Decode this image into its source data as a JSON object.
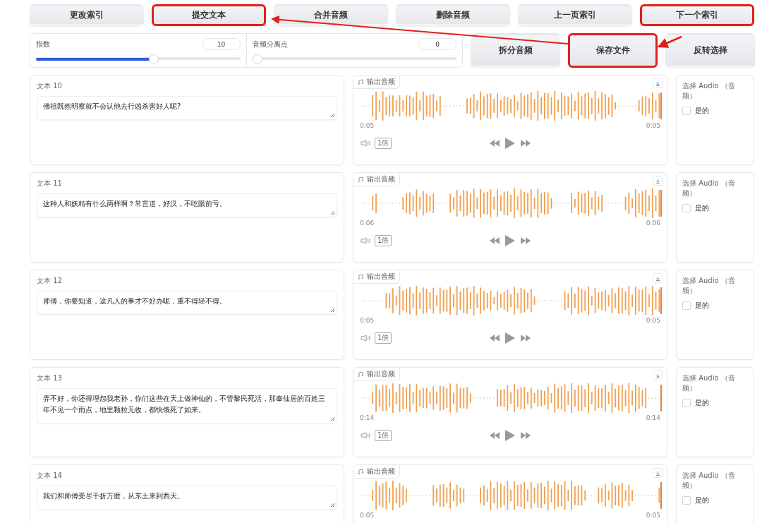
{
  "top_buttons": [
    {
      "label": "更改索引",
      "highlighted": false
    },
    {
      "label": "提交文本",
      "highlighted": true
    },
    {
      "label": "合并音频",
      "highlighted": false
    },
    {
      "label": "删除音频",
      "highlighted": false
    },
    {
      "label": "上一页索引",
      "highlighted": false
    },
    {
      "label": "下一个索引",
      "highlighted": true
    }
  ],
  "sliders": [
    {
      "label": "指数",
      "value": "10",
      "level": 0.58
    },
    {
      "label": "音频分离点",
      "value": "0",
      "level": 0
    }
  ],
  "side_buttons": [
    {
      "label": "拆分音频",
      "highlighted": false
    },
    {
      "label": "保存文件",
      "highlighted": true
    },
    {
      "label": "反转选择",
      "highlighted": false
    }
  ],
  "rows": [
    {
      "label": "文本 10",
      "text": "佛祖既然明察就不会认他去行凶杀害好人呢?",
      "audio": {
        "label": "输出音频",
        "start": "0:05",
        "end": "0:05",
        "speed": "1倍"
      },
      "select": {
        "label": "选择 Audio （音频）",
        "option": "是的",
        "checked": false
      }
    },
    {
      "label": "文本 11",
      "text": "这种人和妖精有什么两样啊？常言道，好汉，不吃眼前亏。",
      "audio": {
        "label": "输出音频",
        "start": "0:06",
        "end": "0:06",
        "speed": "1倍"
      },
      "select": {
        "label": "选择 Audio （音频）",
        "option": "是的",
        "checked": false
      }
    },
    {
      "label": "文本 12",
      "text": "师傅，你要知道，这凡人的事才不好办呢，重不得轻不得。",
      "audio": {
        "label": "输出音频",
        "start": "0:05",
        "end": "0:05",
        "speed": "1倍"
      },
      "select": {
        "label": "选择 Audio （音频）",
        "option": "是的",
        "checked": false
      }
    },
    {
      "label": "文本 13",
      "text": "弄不好，你还得埋怨我老孙，你们这些在天上做神仙的，不管黎民死活，那奉仙居的百姓三年不见一个雨点，地里颗粒无收，都快饿死了如来。",
      "audio": {
        "label": "输出音频",
        "start": "0:14",
        "end": "0:14",
        "speed": "1倍"
      },
      "select": {
        "label": "选择 Audio （音频）",
        "option": "是的",
        "checked": false
      }
    },
    {
      "label": "文本 14",
      "text": "我们和师傅受尽千折万磨，从东土来到西天。",
      "audio": {
        "label": "输出音频",
        "start": "0:05",
        "end": "0:05"
      },
      "select": {
        "label": "选择 Audio （音频）",
        "option": "是的",
        "checked": false
      }
    }
  ]
}
